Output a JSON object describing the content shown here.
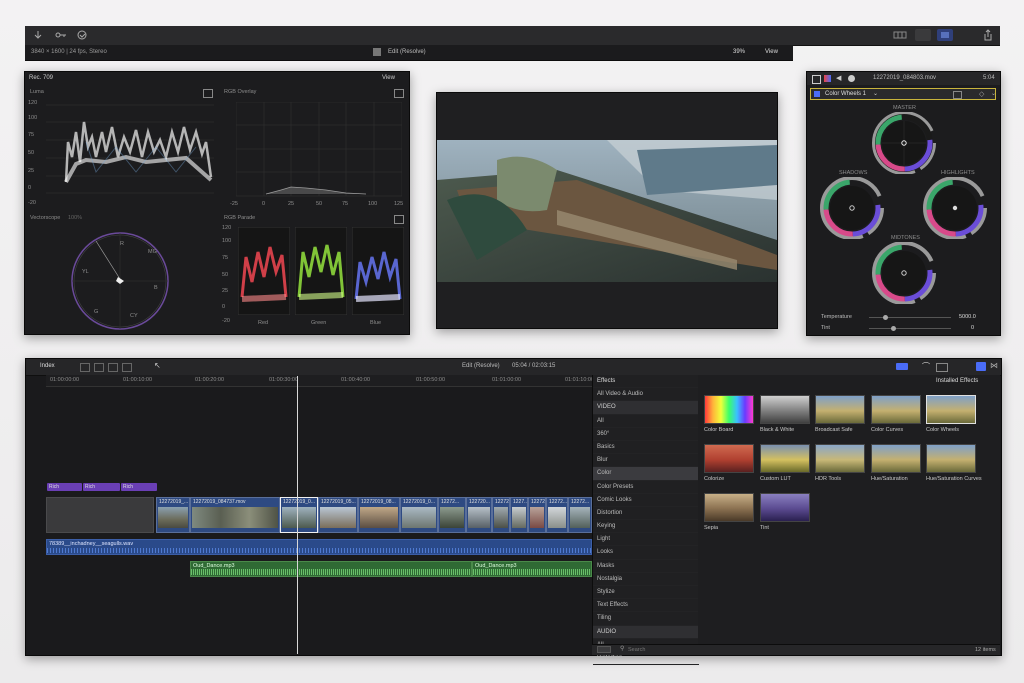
{
  "toolbar": {
    "info": "3840 × 1600 | 24 fps, Stereo",
    "title": "Edit (Resolve)",
    "zoom": "39%",
    "view": "View"
  },
  "scopes": {
    "title": "Rec. 709",
    "view": "View",
    "luma": {
      "label": "Luma",
      "ticks": [
        "120",
        "100",
        "75",
        "50",
        "25",
        "0",
        "-20"
      ]
    },
    "rgb_overlay": {
      "label": "RGB Overlay",
      "xticks": [
        "-25",
        "0",
        "25",
        "50",
        "75",
        "100",
        "125"
      ]
    },
    "vectorscope": {
      "label": "Vectorscope",
      "pct": "100%",
      "targets": [
        "R",
        "MG",
        "B",
        "CY",
        "G",
        "YL"
      ]
    },
    "rgb_parade": {
      "label": "RGB Parade",
      "ticks": [
        "120",
        "100",
        "75",
        "50",
        "25",
        "0",
        "-20"
      ],
      "channels": [
        "Red",
        "Green",
        "Blue"
      ]
    }
  },
  "inspector": {
    "clip_name": "12272019_084803.mov",
    "time": "5:04",
    "effect": "Color Wheels 1",
    "wheels": [
      "MASTER",
      "SHADOWS",
      "HIGHLIGHTS",
      "MIDTONES"
    ],
    "temperature_label": "Temperature",
    "temperature_value": "5000.0",
    "tint_label": "Tint",
    "tint_value": "0"
  },
  "timeline": {
    "index": "Index",
    "project": "Edit (Resolve)",
    "timecode": "05:04 / 02:03:15",
    "ruler": [
      "01:00:00:00",
      "01:00:10:00",
      "01:00:20:00",
      "01:00:30:00",
      "01:00:40:00",
      "01:00:50:00",
      "01:01:00:00",
      "01:01:10:00"
    ],
    "chips": [
      "Rich",
      "Rich",
      "Rich"
    ],
    "clips": [
      {
        "name": "",
        "l": 46,
        "w": 108
      },
      {
        "name": "12272019_...",
        "l": 156,
        "w": 34
      },
      {
        "name": "12272019_084737.mov",
        "l": 190,
        "w": 90
      },
      {
        "name": "12272019_0...",
        "l": 280,
        "w": 38
      },
      {
        "name": "12272019_05...",
        "l": 318,
        "w": 40
      },
      {
        "name": "12272019_08...",
        "l": 358,
        "w": 42
      },
      {
        "name": "12272019_0...",
        "l": 400,
        "w": 38
      },
      {
        "name": "12272...",
        "l": 438,
        "w": 28
      },
      {
        "name": "122720...",
        "l": 466,
        "w": 26
      },
      {
        "name": "12272...",
        "l": 492,
        "w": 18
      },
      {
        "name": "1227...",
        "l": 510,
        "w": 18
      },
      {
        "name": "12272...",
        "l": 528,
        "w": 18
      },
      {
        "name": "12272...",
        "l": 546,
        "w": 22
      },
      {
        "name": "12272...",
        "l": 568,
        "w": 24
      }
    ],
    "audio_main": "78389__inchadney__seagulls.wav",
    "music": [
      "Oud_Dance.mp3",
      "Oud_Dance.mp3"
    ]
  },
  "effects": {
    "header": "Effects",
    "installed": "Installed Effects",
    "categories": [
      "All Video & Audio",
      "VIDEO",
      "All",
      "360°",
      "Basics",
      "Blur",
      "Color",
      "Color Presets",
      "Comic Looks",
      "Distortion",
      "Keying",
      "Light",
      "Looks",
      "Masks",
      "Nostalgia",
      "Stylize",
      "Text Effects",
      "Tiling",
      "AUDIO",
      "All",
      "Distortion"
    ],
    "items": [
      "Color Board",
      "Black & White",
      "Broadcast Safe",
      "Color Curves",
      "Color Wheels",
      "Colorize",
      "Custom LUT",
      "HDR Tools",
      "Hue/Saturation",
      "Hue/Saturation Curves",
      "Sepia",
      "Tint"
    ],
    "search_placeholder": "Search",
    "count": "12 items"
  },
  "colors": {
    "accent": "#4a6cf7",
    "clip_blue": "#2e4a82",
    "audio_green": "#3c7a3a",
    "chip_purple": "#6a3fb5",
    "highlight_yellow": "#c8b43c"
  }
}
